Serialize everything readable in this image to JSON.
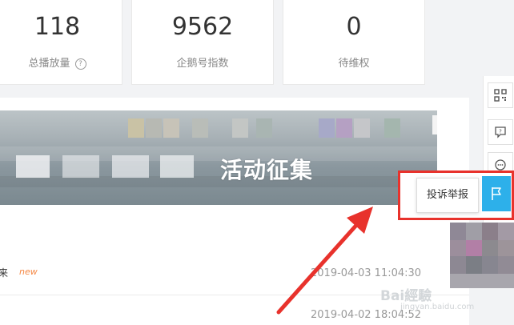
{
  "stats": [
    {
      "value": "118",
      "label": "总播放量",
      "has_help": true
    },
    {
      "value": "9562",
      "label": "企鹅号指数",
      "has_help": false
    },
    {
      "value": "0",
      "label": "待维权",
      "has_help": false
    }
  ],
  "help_glyph": "?",
  "banner": {
    "text": "活动征集"
  },
  "rows": [
    {
      "title": "来",
      "badge": "new",
      "time": "2019-04-03 11:04:30"
    },
    {
      "title": "",
      "badge": "",
      "time": "2019-04-02 18:04:52"
    }
  ],
  "side_toolbar": {
    "icons": [
      "qr-code-icon",
      "help-icon",
      "chat-icon",
      "flag-icon"
    ],
    "report_tooltip": "投诉举报"
  },
  "colors": {
    "accent": "#2db0ea",
    "highlight_box": "#e8322c",
    "new_badge": "#f58845"
  },
  "watermark": {
    "text": "Bai經驗",
    "sub": "jingyan.baidu.com"
  }
}
